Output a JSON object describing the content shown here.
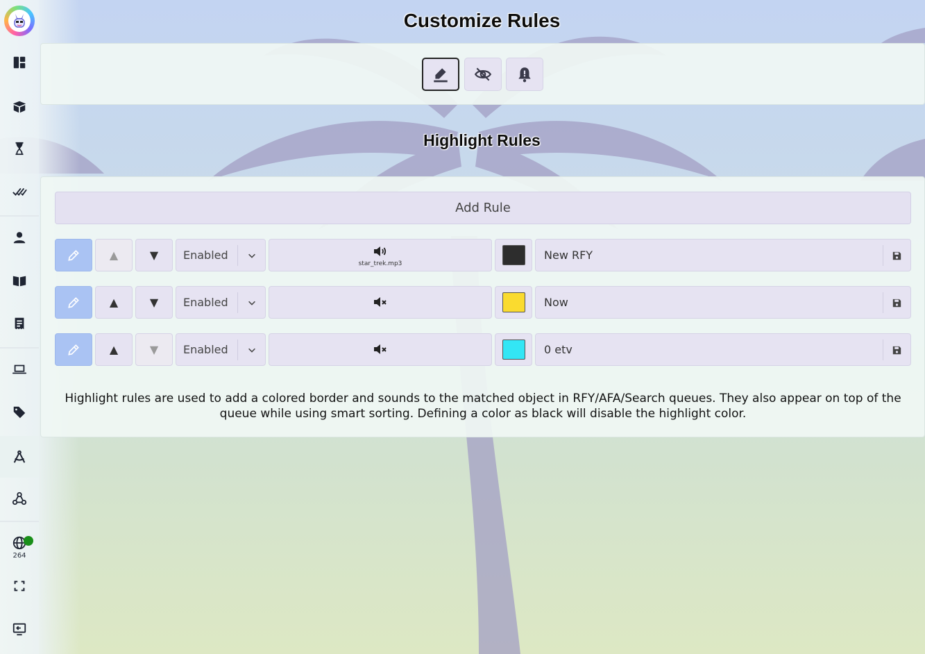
{
  "title": "Customize Rules",
  "section_title": "Highlight Rules",
  "sidebar": {
    "items": [
      {
        "icon": "dashboard-icon"
      },
      {
        "icon": "box-icon"
      },
      {
        "icon": "hourglass-icon"
      },
      {
        "icon": "double-check-icon"
      },
      {
        "icon": "user-icon"
      },
      {
        "icon": "book-icon"
      },
      {
        "icon": "receipt-icon"
      },
      {
        "icon": "laptop-icon"
      },
      {
        "icon": "tag-icon"
      },
      {
        "icon": "compass-icon"
      },
      {
        "icon": "webhook-icon"
      },
      {
        "icon": "globe-icon",
        "count": "264",
        "status_color": "#1a8f1a"
      },
      {
        "icon": "fullscreen-icon"
      },
      {
        "icon": "exit-icon"
      }
    ]
  },
  "toolbar": {
    "buttons": [
      {
        "icon": "highlight-pen-icon",
        "selected": true
      },
      {
        "icon": "eye-slash-icon"
      },
      {
        "icon": "bell-icon"
      }
    ]
  },
  "rules": {
    "add_label": "Add Rule",
    "items": [
      {
        "status": "Enabled",
        "sound_icon": "volume-on-icon",
        "sound_file": "star_trek.mp3",
        "color": "#2d2d2d",
        "name": "New RFY"
      },
      {
        "status": "Enabled",
        "sound_icon": "volume-mute-icon",
        "sound_file": "",
        "color": "#fadb2f",
        "name": "Now"
      },
      {
        "status": "Enabled",
        "sound_icon": "volume-mute-icon",
        "sound_file": "",
        "color": "#33e6f5",
        "name": "0 etv"
      }
    ]
  },
  "help_text": "Highlight rules are used to add a colored border and sounds to the matched object in RFY/AFA/Search queues. They also appear on top of the queue while using smart sorting. Defining a color as black will disable the highlight color."
}
